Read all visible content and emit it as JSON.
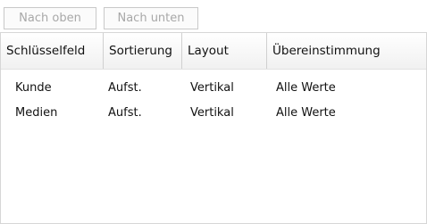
{
  "toolbar": {
    "move_up_label": "Nach oben",
    "move_down_label": "Nach unten"
  },
  "grid": {
    "columns": [
      "Schlüsselfeld",
      "Sortierung",
      "Layout",
      "Übereinstimmung"
    ],
    "rows": [
      [
        "Kunde",
        "Aufst.",
        "Vertikal",
        "Alle Werte"
      ],
      [
        "Medien",
        "Aufst.",
        "Vertikal",
        "Alle Werte"
      ]
    ]
  },
  "colors": {
    "disabled_button_text": "#a8a8a8",
    "border": "#c9c9c9",
    "header_bg_top": "#ffffff",
    "header_bg_bottom": "#f1f1f1"
  }
}
